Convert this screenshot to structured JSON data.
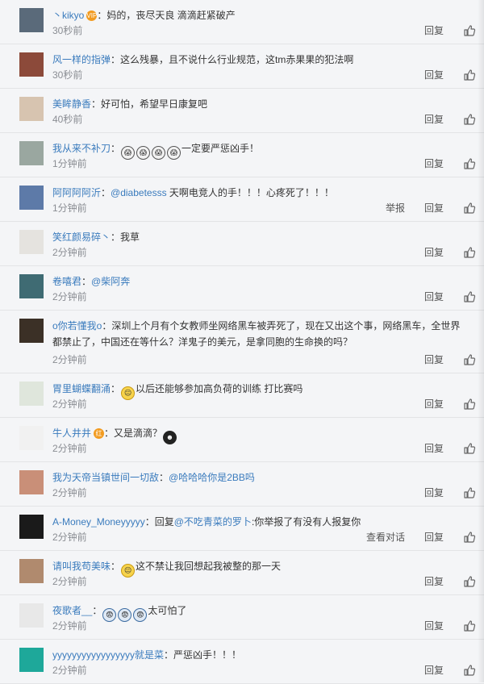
{
  "comments": [
    {
      "user": "丶kikyo",
      "badge": "VIP",
      "parts": [
        {
          "t": "sep",
          "v": "："
        },
        {
          "t": "text",
          "v": "妈的，丧尽天良 滴滴赶紧破产"
        }
      ],
      "time": "30秒前",
      "actions": [
        "回复"
      ],
      "avatar": "#5a6a7a"
    },
    {
      "user": "风一样的指弹",
      "parts": [
        {
          "t": "sep",
          "v": "："
        },
        {
          "t": "text",
          "v": "这么残暴，且不说什么行业规范，这tm赤果果的犯法啊"
        }
      ],
      "time": "30秒前",
      "actions": [
        "回复"
      ],
      "avatar": "#8c4a3a"
    },
    {
      "user": "美眸静香",
      "parts": [
        {
          "t": "sep",
          "v": "："
        },
        {
          "t": "text",
          "v": "好可怕，希望早日康复吧"
        }
      ],
      "time": "40秒前",
      "actions": [
        "回复"
      ],
      "avatar": "#d7c4b0"
    },
    {
      "user": "我从来不补刀",
      "parts": [
        {
          "t": "sep",
          "v": "："
        },
        {
          "t": "emoji",
          "v": "scream"
        },
        {
          "t": "emoji",
          "v": "scream"
        },
        {
          "t": "emoji",
          "v": "scream"
        },
        {
          "t": "emoji",
          "v": "scream"
        },
        {
          "t": "text",
          "v": "一定要严惩凶手！"
        }
      ],
      "time": "1分钟前",
      "actions": [
        "回复"
      ],
      "avatar": "#9aa7a0"
    },
    {
      "user": "阿阿阿阿沂",
      "parts": [
        {
          "t": "sep",
          "v": "："
        },
        {
          "t": "at",
          "v": "@diabetesss"
        },
        {
          "t": "text",
          "v": " 天啊电竞人的手！！！心疼死了！！！"
        }
      ],
      "time": "1分钟前",
      "actions": [
        "举报",
        "回复"
      ],
      "avatar": "#5d7aa8"
    },
    {
      "user": "笑红颜易碎丶",
      "parts": [
        {
          "t": "sep",
          "v": "："
        },
        {
          "t": "text",
          "v": "我草"
        }
      ],
      "time": "2分钟前",
      "actions": [
        "回复"
      ],
      "avatar": "#e5e3df"
    },
    {
      "user": "卷嘻君",
      "parts": [
        {
          "t": "sep",
          "v": "："
        },
        {
          "t": "at",
          "v": "@柴阿奔"
        }
      ],
      "time": "2分钟前",
      "actions": [
        "回复"
      ],
      "avatar": "#3f6b73"
    },
    {
      "user": "o你若懂我o",
      "parts": [
        {
          "t": "sep",
          "v": "："
        },
        {
          "t": "text",
          "v": "深圳上个月有个女教师坐网络黑车被弄死了，现在又出这个事，网络黑车，全世界都禁止了，中国还在等什么？洋鬼子的美元，是拿同胞的生命换的吗？"
        }
      ],
      "time": "2分钟前",
      "actions": [
        "回复"
      ],
      "avatar": "#3b3026",
      "tall": true
    },
    {
      "user": "胃里蝴蝶翻涌",
      "parts": [
        {
          "t": "sep",
          "v": "："
        },
        {
          "t": "emoji",
          "v": "face"
        },
        {
          "t": "text",
          "v": "以后还能够参加高负荷的训练 打比赛吗"
        }
      ],
      "time": "2分钟前",
      "actions": [
        "回复"
      ],
      "avatar": "#dfe6dc"
    },
    {
      "user": "牛人井井",
      "badge": "红",
      "parts": [
        {
          "t": "sep",
          "v": "："
        },
        {
          "t": "text",
          "v": "又是滴滴？"
        },
        {
          "t": "emoji",
          "v": "dark"
        }
      ],
      "time": "2分钟前",
      "actions": [
        "回复"
      ],
      "avatar": "#f1f1f1"
    },
    {
      "user": "我为天帝当镇世间一切敌",
      "parts": [
        {
          "t": "sep",
          "v": "："
        },
        {
          "t": "at",
          "v": "@哈哈哈你是2BB吗"
        }
      ],
      "time": "2分钟前",
      "actions": [
        "回复"
      ],
      "avatar": "#c98f78"
    },
    {
      "user": "A-Money_Moneyyyyy",
      "parts": [
        {
          "t": "sep",
          "v": "："
        },
        {
          "t": "text",
          "v": "回复"
        },
        {
          "t": "at",
          "v": "@不吃青菜的罗卜"
        },
        {
          "t": "text",
          "v": ":你举报了有没有人报复你"
        }
      ],
      "time": "2分钟前",
      "actions": [
        "查看对话",
        "回复"
      ],
      "avatar": "#1a1a1a"
    },
    {
      "user": "请叫我苟美味",
      "parts": [
        {
          "t": "sep",
          "v": "："
        },
        {
          "t": "emoji",
          "v": "face"
        },
        {
          "t": "text",
          "v": "这不禁让我回想起我被整的那一天"
        }
      ],
      "time": "2分钟前",
      "actions": [
        "回复"
      ],
      "avatar": "#b08a6e"
    },
    {
      "user": "夜歌者__",
      "parts": [
        {
          "t": "sep",
          "v": "："
        },
        {
          "t": "emoji",
          "v": "blue"
        },
        {
          "t": "emoji",
          "v": "blue"
        },
        {
          "t": "emoji",
          "v": "blue"
        },
        {
          "t": "text",
          "v": "太可怕了"
        }
      ],
      "time": "2分钟前",
      "actions": [
        "回复"
      ],
      "avatar": "#e8e8e8"
    },
    {
      "user": "yyyyyyyyyyyyyyyyy就是菜",
      "parts": [
        {
          "t": "sep",
          "v": "："
        },
        {
          "t": "text",
          "v": "严惩凶手！！！"
        }
      ],
      "time": "2分钟前",
      "actions": [
        "回复"
      ],
      "avatar": "#1ea89a"
    }
  ],
  "colors": {
    "link": "#3a7bbd",
    "time": "#8a8d93",
    "background": "#f4f5f7"
  },
  "icons": {
    "like": "thumbs-up-icon"
  }
}
